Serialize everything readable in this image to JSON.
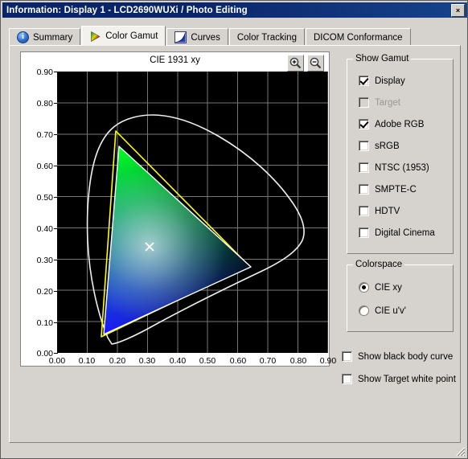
{
  "window": {
    "title": "Information: Display 1 - LCD2690WUXi / Photo Editing",
    "close_label": "×"
  },
  "tabs": [
    {
      "label": "Summary",
      "icon": "info-icon",
      "active": false
    },
    {
      "label": "Color Gamut",
      "icon": "gamut-icon",
      "active": true
    },
    {
      "label": "Curves",
      "icon": "curves-icon",
      "active": false
    },
    {
      "label": "Color Tracking",
      "icon": "",
      "active": false
    },
    {
      "label": "DICOM Conformance",
      "icon": "",
      "active": false
    }
  ],
  "chart_panel": {
    "title": "CIE 1931 xy",
    "zoom_in_label": "+",
    "zoom_out_label": "−"
  },
  "show_gamut": {
    "title": "Show Gamut",
    "items": [
      {
        "label": "Display",
        "checked": true,
        "disabled": false
      },
      {
        "label": "Target",
        "checked": false,
        "disabled": true
      },
      {
        "label": "Adobe RGB",
        "checked": true,
        "disabled": false
      },
      {
        "label": "sRGB",
        "checked": false,
        "disabled": false
      },
      {
        "label": "NTSC (1953)",
        "checked": false,
        "disabled": false
      },
      {
        "label": "SMPTE-C",
        "checked": false,
        "disabled": false
      },
      {
        "label": "HDTV",
        "checked": false,
        "disabled": false
      },
      {
        "label": "Digital Cinema",
        "checked": false,
        "disabled": false
      }
    ]
  },
  "colorspace": {
    "title": "Colorspace",
    "options": [
      {
        "label": "CIE xy",
        "selected": true
      },
      {
        "label": "CIE u'v'",
        "selected": false
      }
    ]
  },
  "extra_options": [
    {
      "label": "Show black body curve",
      "checked": false
    },
    {
      "label": "Show Target white point",
      "checked": false
    }
  ],
  "colors": {
    "titlebar": "#0a246a",
    "face": "#d6d3ce",
    "plot_background": "#000000",
    "display_gamut_outline": "#ffffff",
    "adobe_rgb_outline": "#ffff00",
    "spectral_locus": "#ffffff"
  },
  "chart_data": {
    "type": "scatter",
    "title": "CIE 1931 xy",
    "xlabel": "",
    "ylabel": "",
    "xlim": [
      0.0,
      0.9
    ],
    "ylim": [
      0.0,
      0.9
    ],
    "grid": true,
    "xticks": [
      "0.00",
      "0.10",
      "0.20",
      "0.30",
      "0.40",
      "0.50",
      "0.60",
      "0.70",
      "0.80",
      "0.90"
    ],
    "yticks": [
      "0.00",
      "0.10",
      "0.20",
      "0.30",
      "0.40",
      "0.50",
      "0.60",
      "0.70",
      "0.80",
      "0.90"
    ],
    "series": [
      {
        "name": "Display",
        "type": "filled-gamut-triangle",
        "color": "#ffffff",
        "points": [
          {
            "label": "red",
            "x": 0.645,
            "y": 0.325
          },
          {
            "label": "green",
            "x": 0.205,
            "y": 0.66
          },
          {
            "label": "blue",
            "x": 0.155,
            "y": 0.06
          }
        ]
      },
      {
        "name": "Adobe RGB",
        "type": "outline-triangle",
        "color": "#ffff00",
        "points": [
          {
            "label": "red",
            "x": 0.64,
            "y": 0.33
          },
          {
            "label": "green",
            "x": 0.21,
            "y": 0.71
          },
          {
            "label": "blue",
            "x": 0.15,
            "y": 0.06
          }
        ]
      },
      {
        "name": "Spectral locus",
        "type": "closed-curve",
        "color": "#ffffff"
      }
    ],
    "annotations": [
      {
        "label": "white point marker",
        "marker": "x",
        "x": 0.31,
        "y": 0.33,
        "color": "#ffffff"
      }
    ]
  }
}
